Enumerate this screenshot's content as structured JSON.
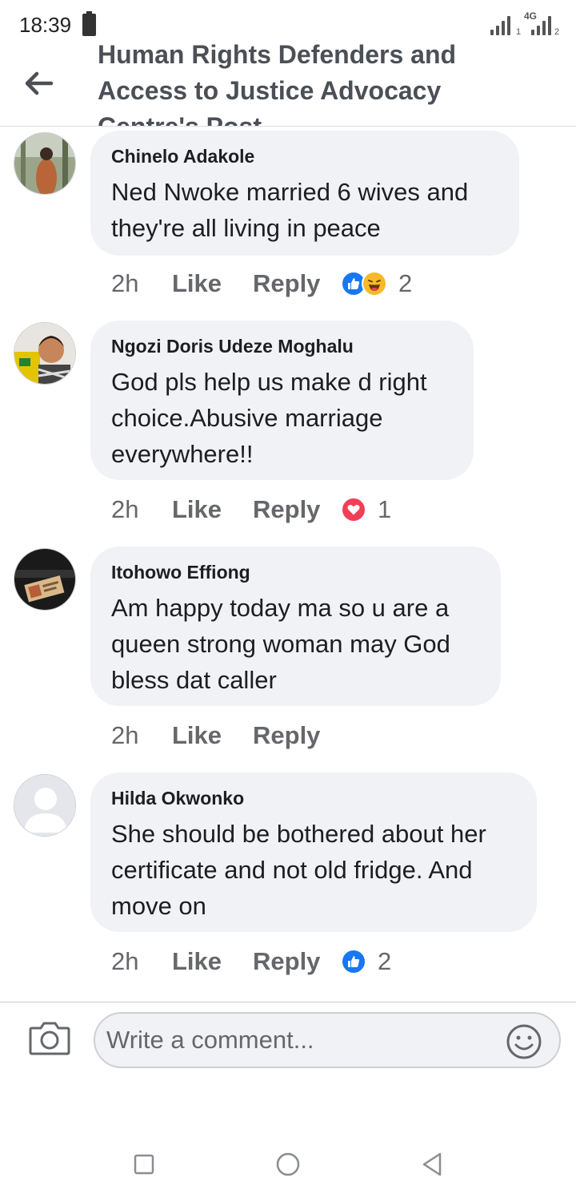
{
  "status_bar": {
    "time": "18:39",
    "network_type": "4G",
    "sim1": "1",
    "sim2": "2"
  },
  "header": {
    "title": "Human Rights Defenders and Access to Justice Advocacy Centre's Post"
  },
  "comments": [
    {
      "author": "Chinelo Adakole",
      "text": "Ned Nwoke married 6 wives and they're all living in peace",
      "time": "2h",
      "like_label": "Like",
      "reply_label": "Reply",
      "reactions": [
        "like-icon",
        "haha-icon"
      ],
      "reaction_count": "2"
    },
    {
      "author": "Ngozi Doris Udeze Moghalu",
      "text": "God pls help us make d right choice.Abusive marriage everywhere!!",
      "time": "2h",
      "like_label": "Like",
      "reply_label": "Reply",
      "reactions": [
        "love-icon"
      ],
      "reaction_count": "1"
    },
    {
      "author": "Itohowo Effiong",
      "text": "Am happy today ma so u are a queen strong woman may God bless dat caller",
      "time": "2h",
      "like_label": "Like",
      "reply_label": "Reply",
      "reactions": [],
      "reaction_count": ""
    },
    {
      "author": "Hilda Okwonko",
      "text": "She should be bothered about her certificate and not old fridge. And move on",
      "time": "2h",
      "like_label": "Like",
      "reply_label": "Reply",
      "reactions": [
        "like-icon"
      ],
      "reaction_count": "2"
    }
  ],
  "composer": {
    "placeholder": "Write a comment..."
  },
  "colors": {
    "like_blue": "#1877f2",
    "love_red": "#f33e58",
    "haha_yellow": "#f7b928",
    "bubble_bg": "#f0f2f5",
    "secondary_text": "#65676b"
  }
}
